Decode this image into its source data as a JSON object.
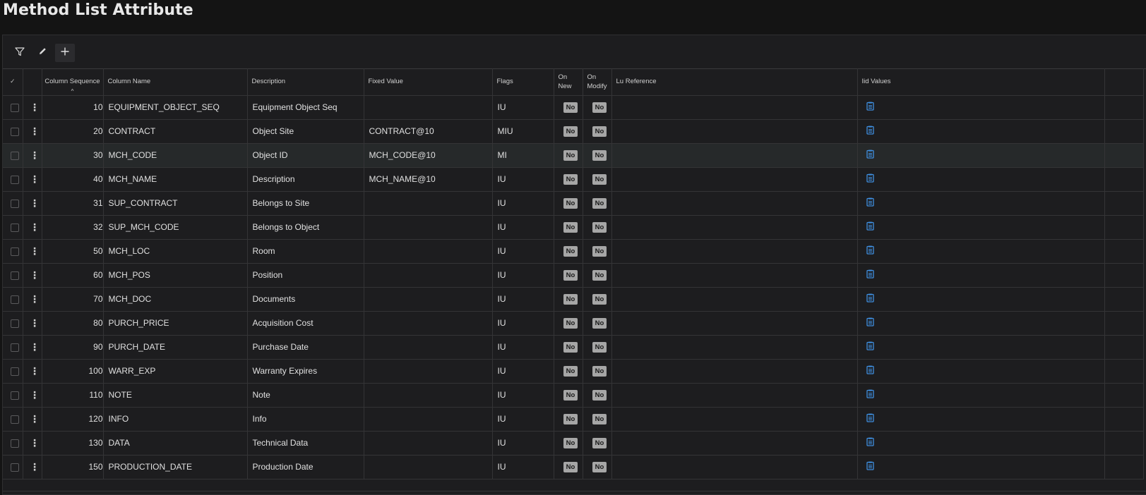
{
  "page": {
    "title": "Method List Attribute"
  },
  "toolbar": {
    "filter_icon": "filter-icon",
    "edit_icon": "pencil-icon",
    "add_icon": "plus-icon"
  },
  "columns": {
    "select": "✓",
    "sequence": "Column Sequence",
    "sort_indicator": "^",
    "name": "Column Name",
    "description": "Description",
    "fixed_value": "Fixed Value",
    "flags": "Flags",
    "on_new": "On New",
    "on_modify": "On Modify",
    "lu_reference": "Lu Reference",
    "iid_values": "Iid Values"
  },
  "colors": {
    "background": "#141414",
    "panel": "#1d1d1f",
    "badge": "#a6a6a6",
    "icon_blue": "#3f8fe0"
  },
  "rows": [
    {
      "seq": "10",
      "name": "EQUIPMENT_OBJECT_SEQ",
      "desc": "Equipment Object Seq",
      "fixed": "",
      "flags": "IU",
      "on_new": "No",
      "on_modify": "No",
      "lu": ""
    },
    {
      "seq": "20",
      "name": "CONTRACT",
      "desc": "Object Site",
      "fixed": "CONTRACT@10",
      "flags": "MIU",
      "on_new": "No",
      "on_modify": "No",
      "lu": ""
    },
    {
      "seq": "30",
      "name": "MCH_CODE",
      "desc": "Object ID",
      "fixed": "MCH_CODE@10",
      "flags": "MI",
      "on_new": "No",
      "on_modify": "No",
      "lu": ""
    },
    {
      "seq": "40",
      "name": "MCH_NAME",
      "desc": "Description",
      "fixed": "MCH_NAME@10",
      "flags": "IU",
      "on_new": "No",
      "on_modify": "No",
      "lu": ""
    },
    {
      "seq": "31",
      "name": "SUP_CONTRACT",
      "desc": "Belongs to Site",
      "fixed": "",
      "flags": "IU",
      "on_new": "No",
      "on_modify": "No",
      "lu": ""
    },
    {
      "seq": "32",
      "name": "SUP_MCH_CODE",
      "desc": "Belongs to Object",
      "fixed": "",
      "flags": "IU",
      "on_new": "No",
      "on_modify": "No",
      "lu": ""
    },
    {
      "seq": "50",
      "name": "MCH_LOC",
      "desc": "Room",
      "fixed": "",
      "flags": "IU",
      "on_new": "No",
      "on_modify": "No",
      "lu": ""
    },
    {
      "seq": "60",
      "name": "MCH_POS",
      "desc": "Position",
      "fixed": "",
      "flags": "IU",
      "on_new": "No",
      "on_modify": "No",
      "lu": ""
    },
    {
      "seq": "70",
      "name": "MCH_DOC",
      "desc": "Documents",
      "fixed": "",
      "flags": "IU",
      "on_new": "No",
      "on_modify": "No",
      "lu": ""
    },
    {
      "seq": "80",
      "name": "PURCH_PRICE",
      "desc": "Acquisition Cost",
      "fixed": "",
      "flags": "IU",
      "on_new": "No",
      "on_modify": "No",
      "lu": ""
    },
    {
      "seq": "90",
      "name": "PURCH_DATE",
      "desc": "Purchase Date",
      "fixed": "",
      "flags": "IU",
      "on_new": "No",
      "on_modify": "No",
      "lu": ""
    },
    {
      "seq": "100",
      "name": "WARR_EXP",
      "desc": "Warranty Expires",
      "fixed": "",
      "flags": "IU",
      "on_new": "No",
      "on_modify": "No",
      "lu": ""
    },
    {
      "seq": "110",
      "name": "NOTE",
      "desc": "Note",
      "fixed": "",
      "flags": "IU",
      "on_new": "No",
      "on_modify": "No",
      "lu": ""
    },
    {
      "seq": "120",
      "name": "INFO",
      "desc": "Info",
      "fixed": "",
      "flags": "IU",
      "on_new": "No",
      "on_modify": "No",
      "lu": ""
    },
    {
      "seq": "130",
      "name": "DATA",
      "desc": "Technical Data",
      "fixed": "",
      "flags": "IU",
      "on_new": "No",
      "on_modify": "No",
      "lu": ""
    },
    {
      "seq": "150",
      "name": "PRODUCTION_DATE",
      "desc": "Production Date",
      "fixed": "",
      "flags": "IU",
      "on_new": "No",
      "on_modify": "No",
      "lu": ""
    }
  ],
  "selected_row": 2
}
